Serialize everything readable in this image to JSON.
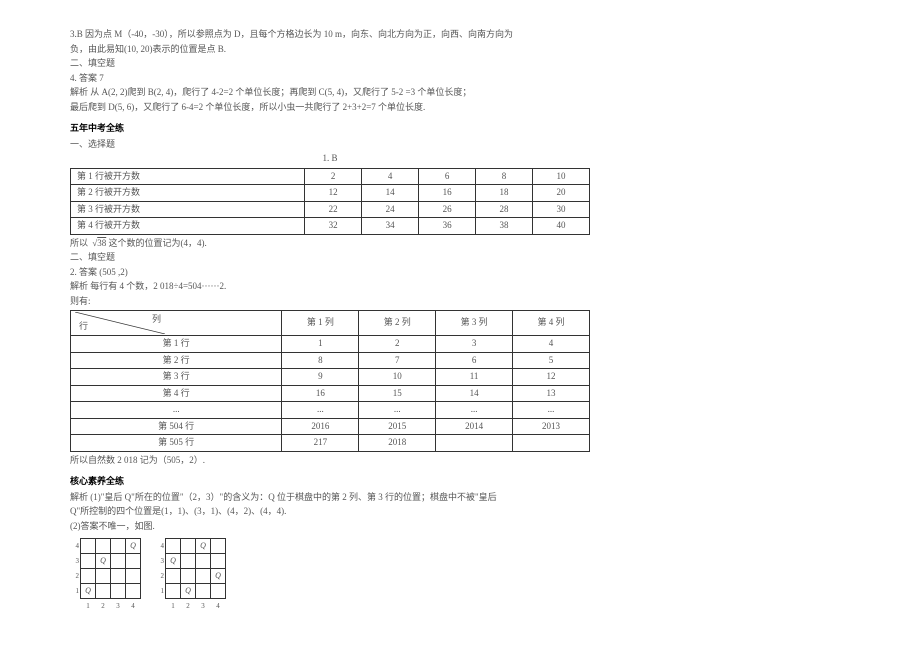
{
  "p1": {
    "l1": "3.B 因为点 M（-40，-30），所以参照点为 D，且每个方格边长为 10 m，向东、向北方向为正，向西、向南方向为",
    "l2": "负，由此易知(10, 20)表示的位置是点 B.",
    "l3": "二、填空题",
    "l4": "4. 答案 7",
    "l5": "解析 从 A(2, 2)爬到 B(2, 4)，爬行了 4-2=2 个单位长度；再爬到 C(5, 4)，又爬行了 5-2 =3 个单位长度；",
    "l6": "最后爬到 D(5, 6)，又爬行了 6-4=2 个单位长度，所以小虫一共爬行了 2+3+2=7 个单位长度."
  },
  "s1": {
    "title": "五年中考全练",
    "l1": "一、选择题",
    "l2": "1. B"
  },
  "table1": {
    "r1": [
      "第 1 行被开方数",
      "2",
      "4",
      "6",
      "8",
      "10"
    ],
    "r2": [
      "第 2 行被开方数",
      "12",
      "14",
      "16",
      "18",
      "20"
    ],
    "r3": [
      "第 3 行被开方数",
      "22",
      "24",
      "26",
      "28",
      "30"
    ],
    "r4": [
      "第 4 行被开方数",
      "32",
      "34",
      "36",
      "38",
      "40"
    ]
  },
  "p2": {
    "l1a": "所以",
    "sqrt": "√",
    "rad": "38",
    "l1b": "这个数的位置记为(4，4).",
    "l2": "二、填空题",
    "l3": "2. 答案 (505 ,2)",
    "l4": "解析 每行有 4 个数，2 018÷4=504······2.",
    "l5": "则有:"
  },
  "table2": {
    "diag": {
      "a": "列",
      "b": "行"
    },
    "head": [
      "第 1 列",
      "第 2 列",
      "第 3 列",
      "第 4 列"
    ],
    "rows": [
      {
        "h": "第 1 行",
        "c": [
          "1",
          "2",
          "3",
          "4"
        ]
      },
      {
        "h": "第 2 行",
        "c": [
          "8",
          "7",
          "6",
          "5"
        ]
      },
      {
        "h": "第 3 行",
        "c": [
          "9",
          "10",
          "11",
          "12"
        ]
      },
      {
        "h": "第 4 行",
        "c": [
          "16",
          "15",
          "14",
          "13"
        ]
      },
      {
        "h": "...",
        "c": [
          "...",
          "...",
          "...",
          "..."
        ]
      },
      {
        "h": "第 504 行",
        "c": [
          "2016",
          "2015",
          "2014",
          "2013"
        ]
      },
      {
        "h": "第 505 行",
        "c": [
          "217",
          "2018",
          "",
          ""
        ]
      }
    ]
  },
  "p3": {
    "l1": "所以自然数 2 018 记为（505，2）."
  },
  "s2": {
    "title": "核心素养全练",
    "l1": "解析 (1)\"皇后 Q\"所在的位置\"（2，3）\"的含义为：Q 位于棋盘中的第 2 列、第 3 行的位置；棋盘中不被\"皇后",
    "l2": "Q\"所控制的四个位置是(1，1)、(3，1)、(4，2)、(4，4).",
    "l3": "(2)答案不唯一，如图."
  },
  "board1": {
    "rows": [
      [
        "",
        "",
        "",
        "Q"
      ],
      [
        "",
        "Q",
        "",
        ""
      ],
      [
        "",
        "",
        "",
        ""
      ],
      [
        "Q",
        "",
        "",
        " "
      ]
    ],
    "cols": [
      "1",
      "2",
      "3",
      "4"
    ],
    "sides": [
      "4",
      "3",
      "2",
      "1"
    ]
  },
  "board2": {
    "rows": [
      [
        "",
        "",
        "Q",
        ""
      ],
      [
        "Q",
        "",
        "",
        ""
      ],
      [
        "",
        "",
        "",
        "Q"
      ],
      [
        "",
        "Q",
        "",
        ""
      ]
    ],
    "cols": [
      "1",
      "2",
      "3",
      "4"
    ],
    "sides": [
      "4",
      "3",
      "2",
      "1"
    ]
  }
}
